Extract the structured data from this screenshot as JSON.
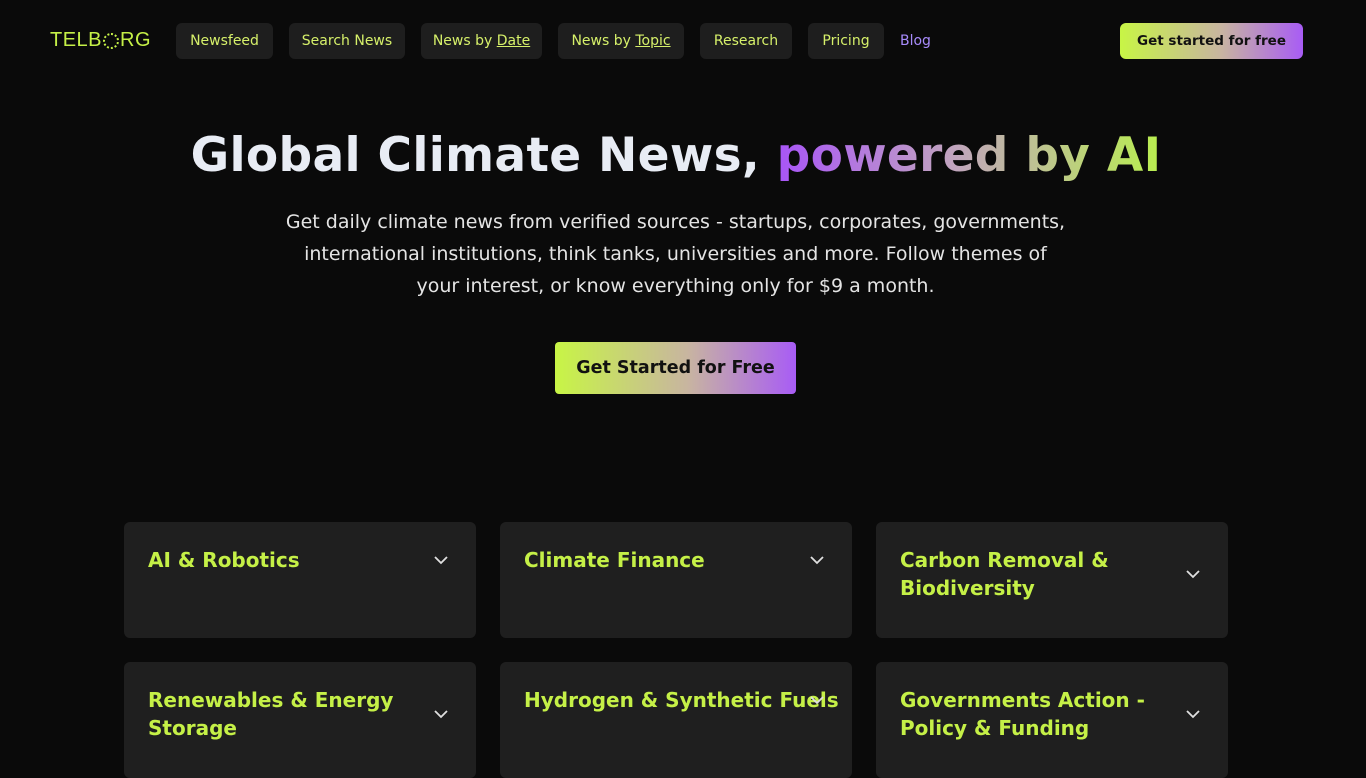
{
  "nav": {
    "logo": {
      "pre": "TELB",
      "post": "RG"
    },
    "items": [
      {
        "label": "Newsfeed"
      },
      {
        "label": "Search News"
      },
      {
        "label": "News by",
        "underlined": "Date"
      },
      {
        "label": "News by",
        "underlined": "Topic"
      },
      {
        "label": "Research"
      },
      {
        "label": "Pricing"
      }
    ],
    "blog": "Blog",
    "cta": "Get started for free"
  },
  "hero": {
    "title_plain": "Global Climate News, ",
    "title_gradient": "powered by AI",
    "subtitle": "Get daily climate news from verified sources - startups, corporates, governments, international institutions, think tanks, universities and more. Follow themes of your interest, or know everything only for $9 a month.",
    "cta": "Get Started for Free"
  },
  "topics": [
    {
      "title": "AI & Robotics"
    },
    {
      "title": "Climate Finance"
    },
    {
      "title": "Carbon Removal & Biodiversity"
    },
    {
      "title": "Renewables & Energy Storage"
    },
    {
      "title": "Hydrogen & Synthetic Fuels"
    },
    {
      "title": "Governments Action - Policy & Funding"
    }
  ],
  "colors": {
    "background": "#0a0a0a",
    "accent_green": "#c5f047",
    "accent_purple": "#a855f7",
    "card": "#1f1f1f"
  }
}
